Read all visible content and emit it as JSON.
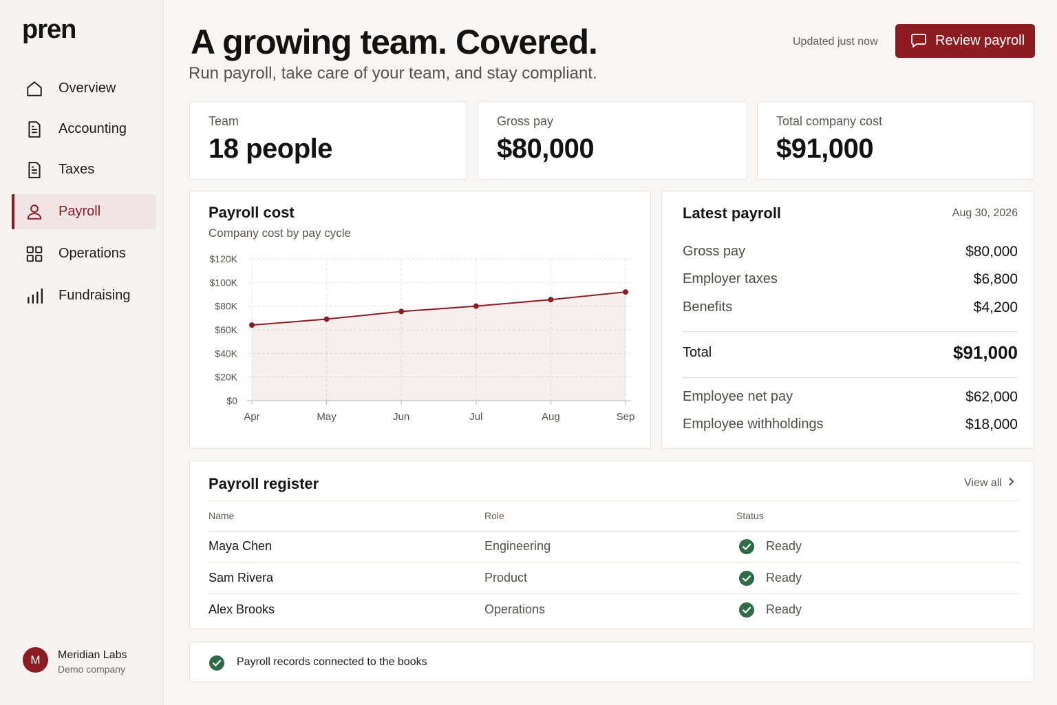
{
  "brand": {
    "logo": "pren"
  },
  "sidebar": {
    "items": [
      {
        "label": "Overview",
        "icon": "home-icon"
      },
      {
        "label": "Accounting",
        "icon": "document-icon"
      },
      {
        "label": "Taxes",
        "icon": "document-icon"
      },
      {
        "label": "Payroll",
        "icon": "person-icon",
        "active": true
      },
      {
        "label": "Operations",
        "icon": "grid-icon"
      },
      {
        "label": "Fundraising",
        "icon": "bar-chart-icon"
      }
    ],
    "company": {
      "initial": "M",
      "name": "Meridian Labs",
      "subtitle": "Demo company"
    }
  },
  "header": {
    "title": "A growing team. Covered.",
    "subtitle": "Run payroll, take care of your team, and stay compliant.",
    "updated": "Updated just now",
    "review_button": "Review payroll"
  },
  "stats": [
    {
      "label": "Team",
      "value": "18 people"
    },
    {
      "label": "Gross pay",
      "value": "$80,000"
    },
    {
      "label": "Total company cost",
      "value": "$91,000"
    }
  ],
  "payroll_cost": {
    "title": "Payroll cost",
    "subtitle": "Company cost by pay cycle"
  },
  "chart_data": {
    "type": "area",
    "title": "Payroll cost",
    "subtitle": "Company cost by pay cycle",
    "categories": [
      "Apr",
      "May",
      "Jun",
      "Jul",
      "Aug",
      "Sep"
    ],
    "series": [
      {
        "values": [
          64000,
          69000,
          75500,
          80000,
          85500,
          92000
        ]
      }
    ],
    "yticks": [
      "$0",
      "$20K",
      "$40K",
      "$60K",
      "$80K",
      "$100K",
      "$120K"
    ],
    "ylim": [
      0,
      120000
    ],
    "xlabel": "",
    "ylabel": "",
    "grid": true,
    "color": "#8c1b22"
  },
  "latest_payroll": {
    "title": "Latest payroll",
    "date": "Aug 30, 2026",
    "rows": [
      {
        "label": "Gross pay",
        "value": "$80,000"
      },
      {
        "label": "Employer taxes",
        "value": "$6,800"
      },
      {
        "label": "Benefits",
        "value": "$4,200"
      }
    ],
    "total": {
      "label": "Total",
      "value": "$91,000"
    },
    "employee_rows": [
      {
        "label": "Employee net pay",
        "value": "$62,000"
      },
      {
        "label": "Employee withholdings",
        "value": "$18,000"
      }
    ]
  },
  "register": {
    "title": "Payroll register",
    "view_all": "View all",
    "columns": [
      "Name",
      "Role",
      "Status"
    ],
    "rows": [
      {
        "name": "Maya Chen",
        "role": "Engineering",
        "status": "Ready"
      },
      {
        "name": "Sam Rivera",
        "role": "Product",
        "status": "Ready"
      },
      {
        "name": "Alex Brooks",
        "role": "Operations",
        "status": "Ready"
      }
    ]
  },
  "footer": {
    "note": "Payroll records connected to the books"
  },
  "colors": {
    "accent": "#8c1b22",
    "success": "#2f6b47"
  }
}
